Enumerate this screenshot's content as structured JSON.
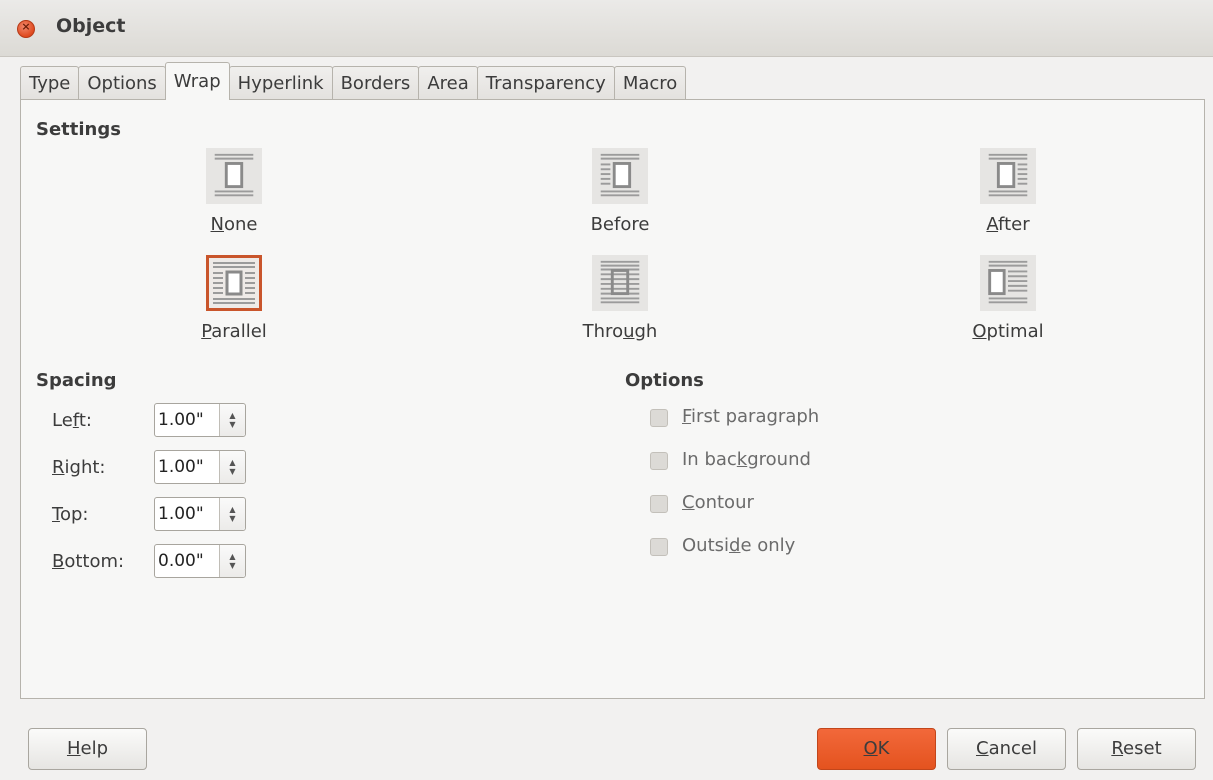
{
  "window": {
    "title": "Object"
  },
  "tabs": [
    "Type",
    "Options",
    "Wrap",
    "Hyperlink",
    "Borders",
    "Area",
    "Transparency",
    "Macro"
  ],
  "active_tab": "Wrap",
  "settings": {
    "title": "Settings",
    "options": [
      {
        "label_pre": "",
        "label_u": "N",
        "label_post": "one",
        "icon": "wrap-none-icon"
      },
      {
        "label_pre": "Before",
        "label_u": "",
        "label_post": "",
        "icon": "wrap-before-icon"
      },
      {
        "label_pre": "",
        "label_u": "A",
        "label_post": "fter",
        "icon": "wrap-after-icon"
      },
      {
        "label_pre": "",
        "label_u": "P",
        "label_post": "arallel",
        "icon": "wrap-parallel-icon",
        "selected": true
      },
      {
        "label_pre": "Thro",
        "label_u": "u",
        "label_post": "gh",
        "icon": "wrap-through-icon"
      },
      {
        "label_pre": "",
        "label_u": "O",
        "label_post": "ptimal",
        "icon": "wrap-optimal-icon"
      }
    ]
  },
  "spacing": {
    "title": "Spacing",
    "fields": [
      {
        "label_pre": "Le",
        "label_u": "f",
        "label_post": "t:",
        "value": "1.00\""
      },
      {
        "label_pre": "",
        "label_u": "R",
        "label_post": "ight:",
        "value": "1.00\""
      },
      {
        "label_pre": "",
        "label_u": "T",
        "label_post": "op:",
        "value": "1.00\""
      },
      {
        "label_pre": "",
        "label_u": "B",
        "label_post": "ottom:",
        "value": "0.00\""
      }
    ]
  },
  "options": {
    "title": "Options",
    "items": [
      {
        "label_pre": "",
        "label_u": "F",
        "label_post": "irst paragraph",
        "checked": false
      },
      {
        "label_pre": "In bac",
        "label_u": "k",
        "label_post": "ground",
        "checked": false
      },
      {
        "label_pre": "",
        "label_u": "C",
        "label_post": "ontour",
        "checked": false
      },
      {
        "label_pre": "Outsi",
        "label_u": "d",
        "label_post": "e only",
        "checked": false
      }
    ]
  },
  "buttons": {
    "help": {
      "label_u": "H",
      "label_post": "elp"
    },
    "ok": {
      "label_u": "O",
      "label_post": "K"
    },
    "cancel": {
      "label_u": "C",
      "label_post": "ancel"
    },
    "reset": {
      "label_u": "R",
      "label_post": "eset"
    }
  },
  "colors": {
    "accent": "#e4531f",
    "selection_border": "#c9552b"
  }
}
